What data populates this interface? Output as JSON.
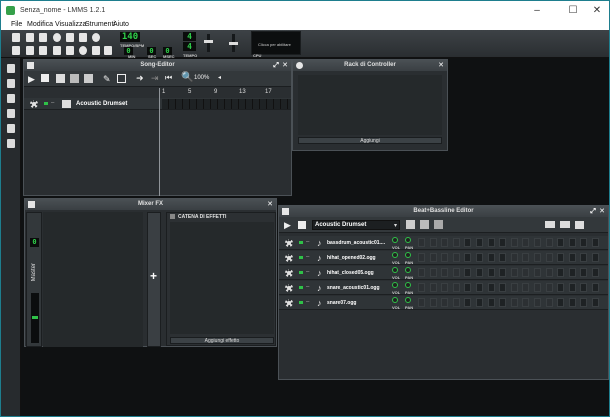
{
  "window": {
    "title": "Senza_nome - LMMS 1.2.1",
    "controls": [
      "–",
      "☐",
      "✕"
    ]
  },
  "menu": [
    "File",
    "Modifica",
    "Visualizza",
    "Strumenti",
    "Aiuto"
  ],
  "toolbar": {
    "tempo_value": "140",
    "tempo_label": "TEMPO/BPM",
    "time_min": "0",
    "time_sec": "0",
    "time_msec": "0",
    "min_label": "MIN",
    "sec_label": "SEC",
    "msec_label": "MSEC",
    "timesig_num": "4",
    "timesig_den": "4",
    "tempo_sig_label": "TEMPO",
    "cpu_hint": "Clicca per abilitare",
    "cpu_label": "CPU"
  },
  "song_editor": {
    "title": "Song-Editor",
    "zoom": "100%",
    "timeline": [
      "1",
      "5",
      "9",
      "13",
      "17"
    ],
    "track_name": "Acoustic Drumset"
  },
  "controller_rack": {
    "title": "Rack di Controller",
    "add_button": "Aggiungi"
  },
  "mixer": {
    "title": "Mixer FX",
    "master_label": "Master",
    "master_value": "0",
    "effects_header": "CATENA DI EFFETTI",
    "add_effect_button": "Aggiungi effetto"
  },
  "beat_editor": {
    "title": "Beat+Bassline Editor",
    "preset": "Acoustic Drumset",
    "vol_label": "VOL",
    "pan_label": "PAN",
    "tracks": [
      {
        "name": "bassdrum_acoustic01...."
      },
      {
        "name": "hihat_opened02.ogg"
      },
      {
        "name": "hihat_closed05.ogg"
      },
      {
        "name": "snare_acoustic01.ogg"
      },
      {
        "name": "snare07.ogg"
      }
    ]
  },
  "colors": {
    "accent_green": "#2fc248",
    "desktop_teal": "#1e7e8e"
  }
}
